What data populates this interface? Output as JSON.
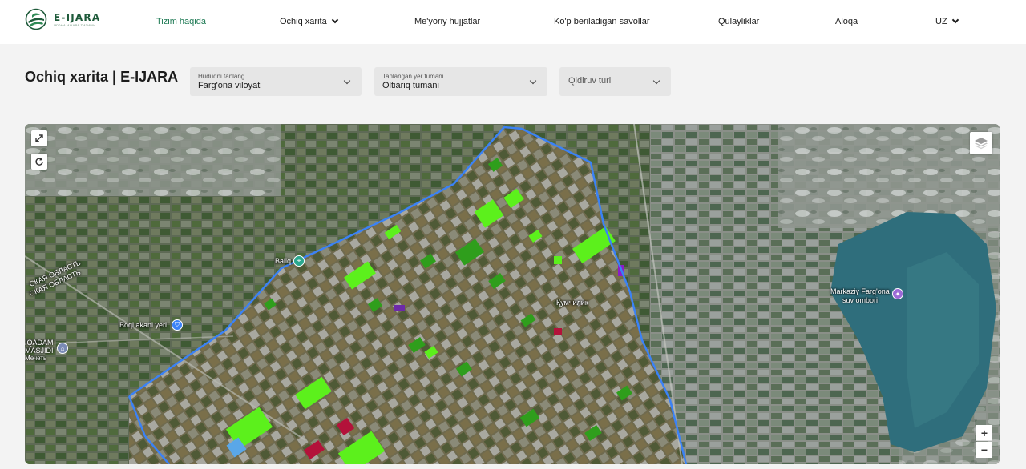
{
  "header": {
    "logo": {
      "title": "E-IJARA",
      "subtitle": "ЯГОНА ИЖАРА ТИЗИМИ"
    },
    "nav": [
      {
        "label": "Tizim haqida",
        "active": true
      },
      {
        "label": "Ochiq xarita",
        "dropdown": true
      },
      {
        "label": "Me'yoriy hujjatlar"
      },
      {
        "label": "Ko'p beriladigan savollar"
      },
      {
        "label": "Qulayliklar"
      },
      {
        "label": "Aloqa"
      },
      {
        "label": "UZ",
        "dropdown": true
      }
    ]
  },
  "title": "Ochiq xarita | E-IJARA",
  "filters": {
    "region": {
      "label": "Hududni tanlang",
      "value": "Farg'ona viloyati"
    },
    "district": {
      "label": "Tanlangan yer tumani",
      "value": "Oltiariq tumani"
    },
    "search_type": {
      "placeholder": "Qidiruv turi"
    }
  },
  "map": {
    "labels": {
      "oblast_1": "СКАЯ ОБЛАСТЬ",
      "oblast_2": "СКАЯ ОБЛАСТЬ",
      "baliq": "Baliq",
      "boqi": "Boqi akani yeri",
      "masjid_1": "IQADAM",
      "masjid_2": "MASJIDI",
      "masjid_3": "Мечеть",
      "town": "Қумчилик",
      "reservoir_1": "Markaziy Farg'ona",
      "reservoir_2": "suv ombori"
    },
    "zoom_in": "+",
    "zoom_out": "−"
  },
  "icons": {
    "expand": "expand-icon",
    "reset": "reset-icon",
    "layers": "layers-icon",
    "logo": "leaf-logo-icon"
  },
  "colors": {
    "accent": "#1f7a55",
    "boundary": "#3b82f6",
    "parcel_bright": "#5cf01c",
    "parcel_dark": "#2f9e1c",
    "parcel_purple": "#8a1ec9",
    "parcel_red": "#b3123a",
    "water": "#2f6e7c"
  }
}
